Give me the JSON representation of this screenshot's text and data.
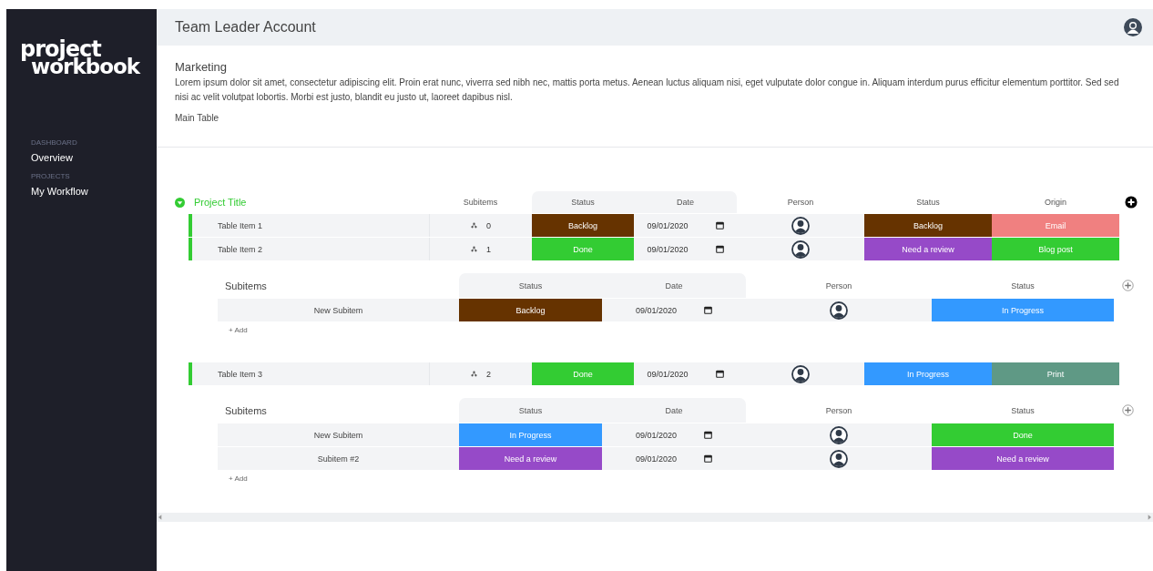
{
  "sidebar": {
    "logo": [
      "project",
      "workbook"
    ],
    "sections": [
      {
        "heading": "DASHBOARD",
        "items": [
          "Overview"
        ]
      },
      {
        "heading": "PROJECTS",
        "items": [
          "My Workflow"
        ]
      }
    ]
  },
  "header": {
    "title": "Team Leader Account"
  },
  "board": {
    "name": "Marketing",
    "description": "Lorem ipsum dolor sit amet, consectetur adipiscing elit. Proin erat nunc, viverra sed nibh nec, mattis porta metus. Aenean luctus aliquam nisi, eget vulputate dolor congue in. Aliquam interdum purus efficitur elementum porttitor. Sed sed nisi ac velit volutpat lobortis. Morbi est justo, blandit eu justo ut, laoreet dapibus nisl.",
    "view": "Main Table"
  },
  "group": {
    "title": "Project Title",
    "expanded": true,
    "columns": [
      "Subitems",
      "Status",
      "Date",
      "Person",
      "Status",
      "Origin"
    ],
    "rows": [
      {
        "name": "Table Item 1",
        "subitems": "0",
        "status": {
          "label": "Backlog",
          "color": "#663300"
        },
        "date": "09/01/2020",
        "status_2": {
          "label": "Backlog",
          "color": "#663300"
        },
        "origin": {
          "label": "Email",
          "color": "#f08080"
        }
      },
      {
        "name": "Table Item 2",
        "subitems": "1",
        "status": {
          "label": "Done",
          "color": "#33cc33"
        },
        "date": "09/01/2020",
        "status_2": {
          "label": "Need a review",
          "color": "#964ac8"
        },
        "origin": {
          "label": "Blog post",
          "color": "#33cc33"
        },
        "subtable": {
          "title": "Subitems",
          "columns": [
            "Status",
            "Date",
            "Person",
            "Status"
          ],
          "add_label": "+ Add",
          "rows": [
            {
              "name": "New Subitem",
              "status": {
                "label": "Backlog",
                "color": "#663300"
              },
              "date": "09/01/2020",
              "status_2": {
                "label": "In Progress",
                "color": "#3399ff"
              }
            }
          ]
        }
      },
      {
        "name": "Table Item 3",
        "subitems": "2",
        "status": {
          "label": "Done",
          "color": "#33cc33"
        },
        "date": "09/01/2020",
        "status_2": {
          "label": "In Progress",
          "color": "#3399ff"
        },
        "origin": {
          "label": "Print",
          "color": "#5f9985"
        },
        "subtable": {
          "title": "Subitems",
          "columns": [
            "Status",
            "Date",
            "Person",
            "Status"
          ],
          "add_label": "+ Add",
          "rows": [
            {
              "name": "New Subitem",
              "status": {
                "label": "In Progress",
                "color": "#3399ff"
              },
              "date": "09/01/2020",
              "status_2": {
                "label": "Done",
                "color": "#33cc33"
              }
            },
            {
              "name": "Subitem #2",
              "status": {
                "label": "Need a review",
                "color": "#964ac8"
              },
              "date": "09/01/2020",
              "status_2": {
                "label": "Need a review",
                "color": "#964ac8"
              }
            }
          ]
        }
      }
    ]
  }
}
